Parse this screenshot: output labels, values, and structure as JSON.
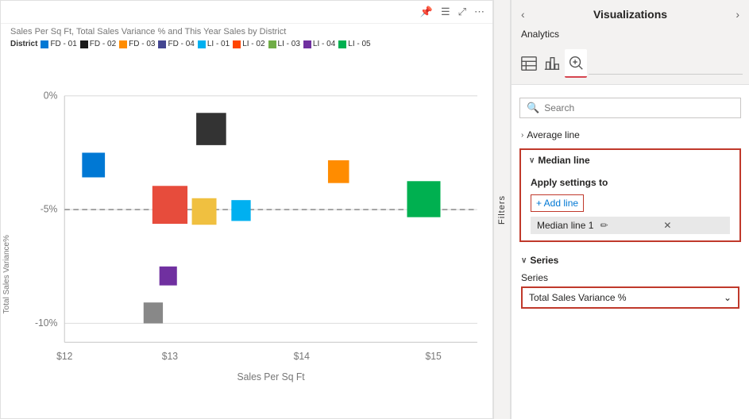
{
  "chart": {
    "title": "Sales Per Sq Ft, Total Sales Variance % and This Year Sales by District",
    "toolbar": {
      "pin_icon": "📌",
      "filter_icon": "☰",
      "expand_icon": "⤢",
      "more_icon": "⋯"
    },
    "legend": {
      "label": "District",
      "items": [
        {
          "id": "FD-01",
          "color": "#0078d4"
        },
        {
          "id": "FD-02",
          "color": "#1a1a1a"
        },
        {
          "id": "FD-03",
          "color": "#ff8c00"
        },
        {
          "id": "FD-04",
          "color": "#444791"
        },
        {
          "id": "LI-01",
          "color": "#00b0f0"
        },
        {
          "id": "LI-02",
          "color": "#ff4500"
        },
        {
          "id": "LI-03",
          "color": "#70ad47"
        },
        {
          "id": "LI-04",
          "color": "#7030a0"
        },
        {
          "id": "LI-05",
          "color": "#00b050"
        }
      ]
    },
    "y_axis": {
      "label": "Total Sales Variance%",
      "ticks": [
        "0%",
        "-5%",
        "-10%"
      ]
    },
    "x_axis": {
      "label": "Sales Per Sq Ft",
      "ticks": [
        "$12",
        "$13",
        "$14",
        "$15"
      ]
    }
  },
  "filters_tab": {
    "label": "Filters"
  },
  "right_panel": {
    "title": "Visualizations",
    "nav_prev": "‹",
    "nav_next": "›",
    "analytics_tab": "Analytics",
    "icons": [
      {
        "id": "table-icon",
        "label": "table"
      },
      {
        "id": "chart-icon",
        "label": "chart"
      },
      {
        "id": "magnify-icon",
        "label": "analytics-active"
      }
    ],
    "search": {
      "placeholder": "Search",
      "icon": "🔍"
    },
    "sections": [
      {
        "id": "average-line",
        "label": "Average line",
        "expanded": false
      },
      {
        "id": "median-line",
        "label": "Median line",
        "expanded": true
      }
    ],
    "apply_settings": {
      "label": "Apply settings to",
      "add_line_btn": "+ Add line",
      "median_line_item": "Median line 1"
    },
    "series": {
      "header": "Series",
      "label": "Series",
      "value": "Total Sales Variance %",
      "chevron": "⌄"
    }
  }
}
